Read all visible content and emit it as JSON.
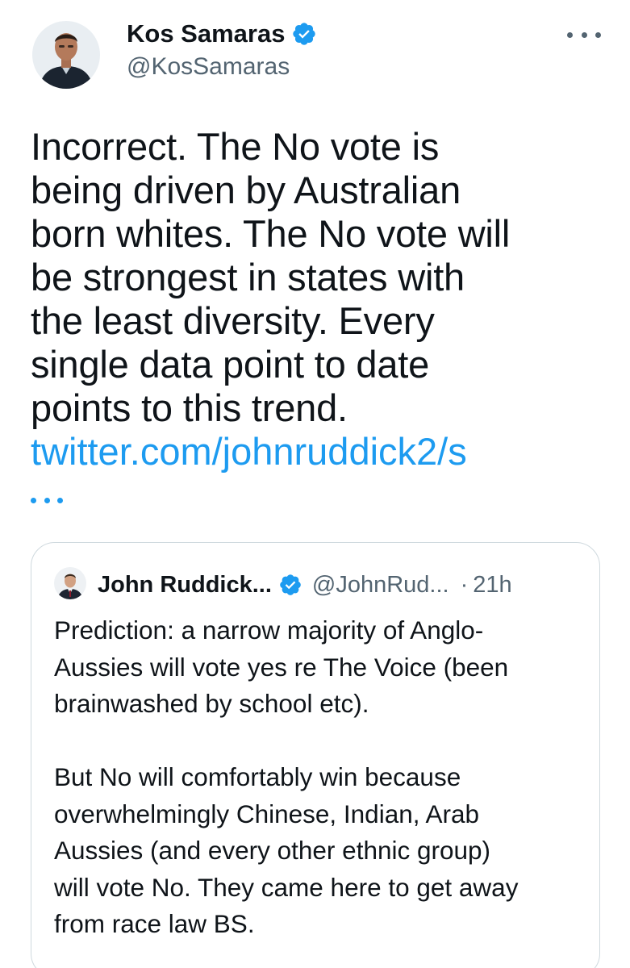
{
  "tweet": {
    "author": {
      "name": "Kos Samaras",
      "handle": "@KosSamaras",
      "verified": true
    },
    "text": "Incorrect. The No vote is\nbeing driven by Australian\nborn whites. The No vote will\nbe strongest in states with\nthe least diversity. Every\nsingle data point to date\npoints to this trend.",
    "link": "twitter.com/johnruddick2/s",
    "more_icon": "more-horizontal-icon",
    "truncation_icon": "ellipsis-icon"
  },
  "quoted_tweet": {
    "author": {
      "name": "John Ruddick...",
      "handle": "@JohnRud...",
      "verified": true
    },
    "separator": "·",
    "time": "21h",
    "text": "Prediction: a narrow majority of Anglo-\nAussies will vote yes re The Voice (been\nbrainwashed by school etc).\n\nBut No will comfortably win because\noverwhelmingly Chinese, Indian, Arab\nAussies (and every other ethnic group)\nwill vote No. They came here to get away\nfrom race law BS."
  },
  "colors": {
    "link": "#1d9bf0",
    "verified_badge": "#1d9bf0",
    "secondary_text": "#536471",
    "border": "#cfd9de"
  }
}
